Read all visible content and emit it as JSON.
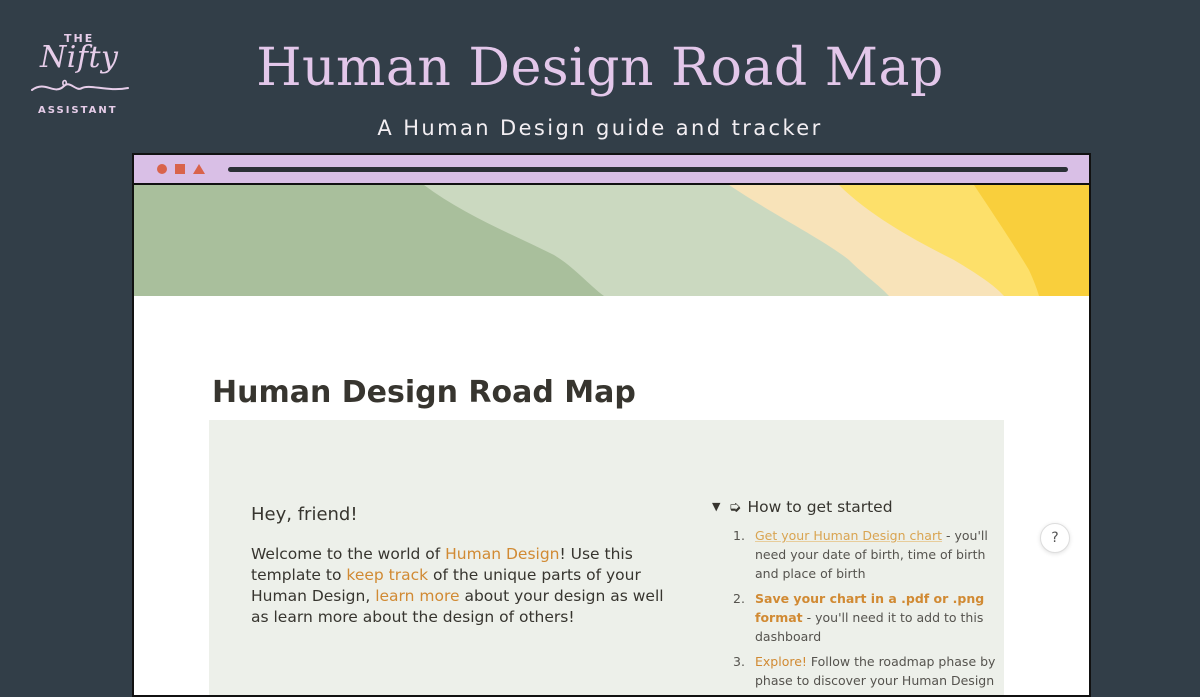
{
  "logo": {
    "top": "THE",
    "middle": "Nifty",
    "bottom": "ASSISTANT"
  },
  "hero": {
    "title": "Human Design Road Map",
    "subtitle": "A Human Design guide and tracker"
  },
  "browser": {
    "controls": [
      "circle-icon",
      "square-icon",
      "triangle-icon"
    ],
    "bar_color": "#d9bfe6",
    "cover_colors": [
      "#a9bf9c",
      "#cbd9c0",
      "#f8e3b9",
      "#fde06a",
      "#f9cf3c"
    ]
  },
  "page": {
    "title": "Human Design Road Map",
    "callout": {
      "greeting": "Hey, friend!",
      "welcome": {
        "t1": "Welcome to the world of ",
        "l1": "Human Design",
        "t2": "! Use this template to ",
        "l2": "keep track",
        "t3": " of the unique parts of your Human Design, ",
        "l3": "learn more",
        "t4": " about your design as well as learn more about the design of others!"
      },
      "toggle": {
        "triangle": "▼",
        "arrow": "➭",
        "label": "How to get started"
      },
      "steps": [
        {
          "num": "1.",
          "link": "Get your Human Design chart",
          "text": " - you'll need your date of birth, time of birth and place of birth"
        },
        {
          "num": "2.",
          "link": "Save your chart in a .pdf or .png format",
          "text": " - you'll need it to add to this dashboard"
        },
        {
          "num": "3.",
          "link": "Explore!",
          "text": " Follow the roadmap phase by phase to discover your Human Design"
        }
      ]
    }
  },
  "help": {
    "label": "?"
  },
  "colors": {
    "background": "#323e48",
    "accent": "#d18a33",
    "lilac": "#e3c7ea",
    "callout_bg": "#edf0ea"
  }
}
